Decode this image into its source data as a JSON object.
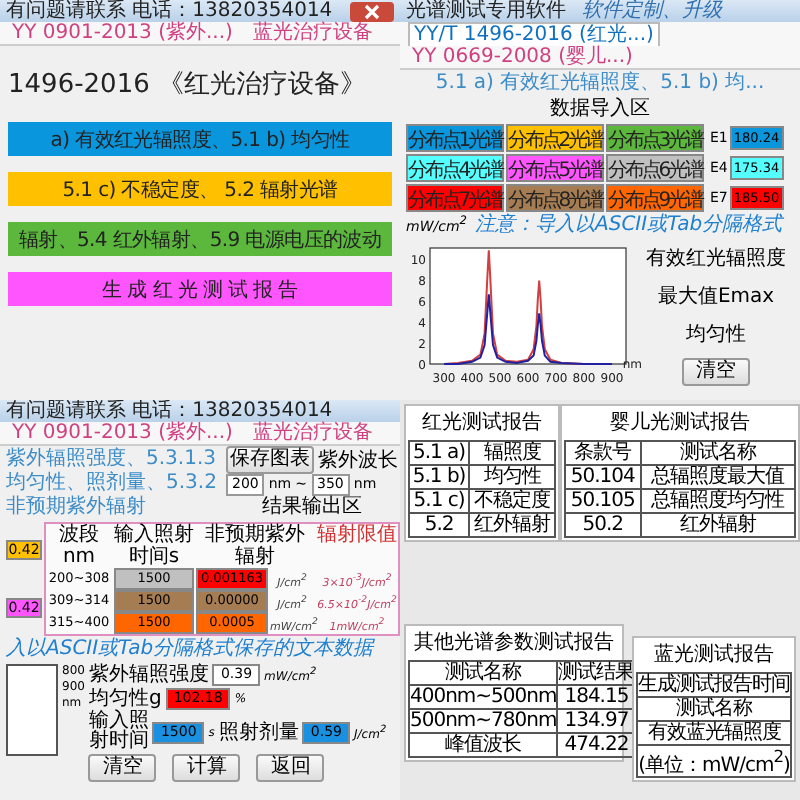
{
  "panels": [
    {
      "kind": "menu",
      "title": "有问题请联系 电话：13820354014",
      "close_button": true,
      "tabs": [
        {
          "label": "YY 0901-2013 (紫外...)",
          "selected": false
        },
        {
          "label": "蓝光治疗设备",
          "selected": false
        }
      ],
      "heading": "1496-2016 《红光治疗设备》",
      "buttons": [
        {
          "label": "a) 有效红光辐照度、5.1 b) 均匀性",
          "color": "#0a96dc"
        },
        {
          "label": "5.1 c) 不稳定度、 5.2 辐射光谱",
          "color": "#ffc000"
        },
        {
          "label": "辐射、5.4 红外辐射、5.9 电源电压的波动",
          "color": "#5cb83c"
        },
        {
          "label": "生 成 红 光 测 试 报 告",
          "color": "#ff55ff"
        }
      ]
    },
    {
      "kind": "import",
      "title": "光谱测试专用软件",
      "title_note": "软件定制、升级",
      "tabs": [
        {
          "label": "YY/T 1496-2016 (红光...)",
          "selected": true
        },
        {
          "label": "YY 0669-2008 (婴儿...)",
          "selected": false
        }
      ],
      "heading": "5.1 a) 有效红光辐照度、5.1 b) 均...",
      "section": "数据导入区",
      "channels": [
        {
          "label": "分布点1光谱",
          "color": "#0a96dc"
        },
        {
          "label": "分布点2光谱",
          "color": "#ffc000"
        },
        {
          "label": "分布点3光谱",
          "color": "#5cb83c"
        },
        {
          "label": "分布点4光谱",
          "color": "#55ffff"
        },
        {
          "label": "分布点5光谱",
          "color": "#ff55ff"
        },
        {
          "label": "分布点6光谱",
          "color": "#c0c0c0"
        },
        {
          "label": "分布点7光谱",
          "color": "#ff0000"
        },
        {
          "label": "分布点8光谱",
          "color": "#a67c52"
        },
        {
          "label": "分布点9光谱",
          "color": "#ff6600"
        }
      ],
      "readings": [
        {
          "label": "E1",
          "value": "180.24",
          "color": "#0a96dc"
        },
        {
          "label": "E4",
          "value": "175.34",
          "color": "#55ffff"
        },
        {
          "label": "E7",
          "value": "185.50",
          "color": "#ff0000"
        }
      ],
      "note": "注意：导入以ASCII或Tab分隔格式",
      "chart_data": {
        "type": "line",
        "ylabel": "mW/cm$^{2}$",
        "xlabel": "nm",
        "xlim": [
          250,
          950
        ],
        "ylim": [
          0,
          11
        ],
        "xticks": [
          300,
          400,
          500,
          600,
          700,
          800,
          900
        ],
        "yticks": [
          10,
          8,
          6,
          4,
          2,
          0
        ],
        "x": [
          300,
          350,
          400,
          430,
          445,
          455,
          460,
          465,
          475,
          490,
          520,
          560,
          600,
          620,
          630,
          635,
          640,
          645,
          650,
          660,
          680,
          720,
          800,
          900
        ],
        "series": [
          {
            "color": "#d04040",
            "values": [
              0,
              0.1,
              0.3,
              0.9,
              2.9,
              8.3,
              10.8,
              8.3,
              2.9,
              0.9,
              0.3,
              0.2,
              0.4,
              1.4,
              3.6,
              6.1,
              7.9,
              6.1,
              3.6,
              1.4,
              0.4,
              0.1,
              0,
              0
            ]
          },
          {
            "color": "#2020a0",
            "values": [
              0,
              0,
              0.2,
              0.6,
              1.8,
              5,
              6.6,
              5,
              1.8,
              0.6,
              0.2,
              0.1,
              0.3,
              0.8,
              2.2,
              3.7,
              4.8,
              3.7,
              2.2,
              0.8,
              0.2,
              0.1,
              0,
              0
            ]
          }
        ]
      },
      "result_labels": [
        "有效红光辐照度",
        "最大值Emax",
        "均匀性"
      ],
      "button": "清空"
    },
    {
      "kind": "uv",
      "title": "有问题请联系 电话：13820354014",
      "tabs": [
        {
          "label": "YY 0901-2013 (紫外...)",
          "selected": false
        },
        {
          "label": "蓝光治疗设备",
          "selected": false
        }
      ],
      "heading": "紫外辐照强度、5.3.1.3均匀性、照剂量、5.3.2非预期紫外辐射",
      "save_button": "保存图表",
      "wavelength": {
        "label": "紫外波长",
        "from": "200",
        "from_unit": "nm",
        "sep": "~",
        "to": "350",
        "to_unit": "nm"
      },
      "section": "结果输出区",
      "side_values": [
        {
          "value": "0.42",
          "color": "#ffc000"
        },
        {
          "value": "0.42",
          "color": "#ff55ff"
        }
      ],
      "columns": [
        "波段nm",
        "输入照射时间s",
        "非预期紫外辐射",
        "辐射限值"
      ],
      "rows": [
        {
          "band": "200~308",
          "time": {
            "text": "1500",
            "color": "#c0c0c0"
          },
          "value": {
            "text": "0.001163",
            "color": "#ff0000"
          },
          "unit": "J/cm$^{2}$",
          "limit": "3×10$^{-3}$J/cm$^{2}$"
        },
        {
          "band": "309~314",
          "time": {
            "text": "1500",
            "color": "#a67c52"
          },
          "value": {
            "text": "0.00000",
            "color": "#a67c52"
          },
          "unit": "J/cm$^{2}$",
          "limit": "6.5×10$^{-2}$J/cm$^{2}$"
        },
        {
          "band": "315~400",
          "time": {
            "text": "1500",
            "color": "#ff6600"
          },
          "value": {
            "text": "0.0005",
            "color": "#ff6600"
          },
          "unit": "mW/cm$^{2}$",
          "limit": "1mW/cm$^{2}$"
        }
      ],
      "note": "入以ASCII或Tab分隔格式保存的文本数据",
      "chart_ticks": [
        "800",
        "900"
      ],
      "chart_unit": "nm",
      "fields": [
        {
          "label": "紫外辐照强度",
          "value": "0.39",
          "unit": "mW/cm$^{2}$",
          "color": "#ffffff"
        },
        {
          "label": "均匀性g",
          "value": "102.18",
          "unit": "%",
          "color": "#ff0000"
        }
      ],
      "dose": {
        "time_label": "输入照射时间",
        "time": "1500",
        "time_unit": "s",
        "dose_label": "照射剂量",
        "dose": "0.59",
        "dose_unit": "J/cm$^{2}$"
      },
      "buttons": [
        "清空",
        "计算",
        "返回"
      ]
    },
    {
      "kind": "reports",
      "documents": [
        {
          "title": "红光测试报告",
          "rows": [
            [
              "5.1 a)",
              "辐照度"
            ],
            [
              "5.1 b)",
              "均匀性"
            ],
            [
              "5.1 c)",
              "不稳定度"
            ],
            [
              "5.2",
              "红外辐射"
            ]
          ]
        },
        {
          "title": "婴儿光测试报告",
          "rows": [
            [
              "条款号",
              "测试名称"
            ],
            [
              "50.104",
              "总辐照度最大值"
            ],
            [
              "50.105",
              "总辐照度均匀性"
            ],
            [
              "50.2",
              "红外辐射"
            ]
          ]
        },
        {
          "title": "其他光谱参数测试报告",
          "rows": [
            [
              "测试名称",
              "测试结果"
            ],
            [
              "400nm~500nm",
              "184.15"
            ],
            [
              "500nm~780nm",
              "134.97"
            ],
            [
              "峰值波长",
              "474.22"
            ]
          ]
        },
        {
          "title": "蓝光测试报告",
          "rows": [
            [
              "生成测试报告时间"
            ],
            [
              "测试名称"
            ],
            [
              "有效蓝光辐照度"
            ],
            [
              "(单位：mW/cm$^{2}$)"
            ]
          ]
        }
      ]
    }
  ]
}
